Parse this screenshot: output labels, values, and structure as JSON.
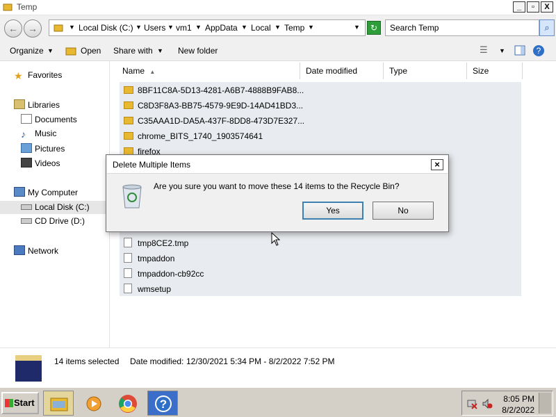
{
  "window": {
    "title": "Temp",
    "controls": {
      "minimize": "_",
      "maximize": "▫",
      "close": "X"
    }
  },
  "address": {
    "back_icon": "←",
    "forward_icon": "→",
    "breadcrumbs": [
      "Local Disk (C:)",
      "Users",
      "vm1",
      "AppData",
      "Local",
      "Temp"
    ],
    "search_placeholder": "Search Temp",
    "search_icon": "⌕",
    "refresh_icon": "↻"
  },
  "toolbar": {
    "organize": "Organize",
    "open": "Open",
    "share_with": "Share with",
    "new_folder": "New folder"
  },
  "nav": {
    "favorites": "Favorites",
    "libraries": "Libraries",
    "documents": "Documents",
    "music": "Music",
    "pictures": "Pictures",
    "videos": "Videos",
    "my_computer": "My Computer",
    "local_disk": "Local Disk (C:)",
    "cd_drive": "CD Drive (D:)",
    "network": "Network"
  },
  "columns": {
    "name": "Name",
    "date_modified": "Date modified",
    "type": "Type",
    "size": "Size"
  },
  "files": [
    {
      "name": "8BF11C8A-5D13-4281-A6B7-4888B9FAB8...",
      "kind": "folder"
    },
    {
      "name": "C8D3F8A3-BB75-4579-9E9D-14AD41BD3...",
      "kind": "folder"
    },
    {
      "name": "C35AAA1D-DA5A-437F-8DD8-473D7E327...",
      "kind": "folder"
    },
    {
      "name": "chrome_BITS_1740_1903574641",
      "kind": "folder"
    },
    {
      "name": "firefox",
      "kind": "folder"
    },
    {
      "name": "tmp8CE2.tmp",
      "kind": "file"
    },
    {
      "name": "tmpaddon",
      "kind": "file"
    },
    {
      "name": "tmpaddon-cb92cc",
      "kind": "file"
    },
    {
      "name": "wmsetup",
      "kind": "file"
    }
  ],
  "dialog": {
    "title": "Delete Multiple Items",
    "close": "×",
    "message": "Are you sure you want to move these 14 items to the Recycle Bin?",
    "yes": "Yes",
    "no": "No"
  },
  "details": {
    "selected": "14 items selected",
    "date_label": "Date modified:",
    "date_range": "12/30/2021 5:34 PM - 8/2/2022 7:52 PM"
  },
  "taskbar": {
    "start": "Start",
    "time": "8:05 PM",
    "date": "8/2/2022"
  }
}
